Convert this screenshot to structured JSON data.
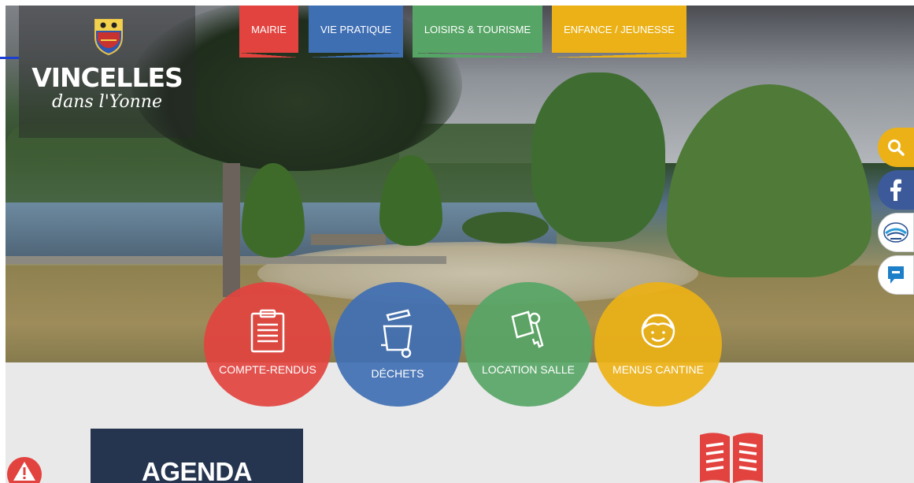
{
  "brand": {
    "name": "VINCELLES",
    "tagline": "dans l'Yonne",
    "crest_icon": "coat-of-arms-icon"
  },
  "nav": {
    "items": [
      {
        "label": "MAIRIE",
        "color": "#e2433f"
      },
      {
        "label": "VIE PRATIQUE",
        "color": "#3f6fb3"
      },
      {
        "label": "LOISIRS & TOURISME",
        "color": "#57a566"
      },
      {
        "label": "ENFANCE / JEUNESSE",
        "color": "#ebb116"
      }
    ]
  },
  "floating": {
    "search_icon": "search-icon",
    "facebook_icon": "facebook-icon",
    "partner_icon": "partner-logo-icon",
    "chat_icon": "chat-icon"
  },
  "quick_links": [
    {
      "label": "COMPTE-RENDUS",
      "icon": "clipboard-icon",
      "color": "#e2433f"
    },
    {
      "label": "DÉCHETS",
      "icon": "trash-bin-icon",
      "color": "#3f6fb3"
    },
    {
      "label": "LOCATION SALLE",
      "icon": "key-icon",
      "color": "#57a566"
    },
    {
      "label": "MENUS CANTINE",
      "icon": "child-face-icon",
      "color": "#ebb116"
    }
  ],
  "agenda": {
    "title": "AGENDA"
  },
  "icons": {
    "book": "open-book-icon",
    "alert": "alert-icon"
  }
}
